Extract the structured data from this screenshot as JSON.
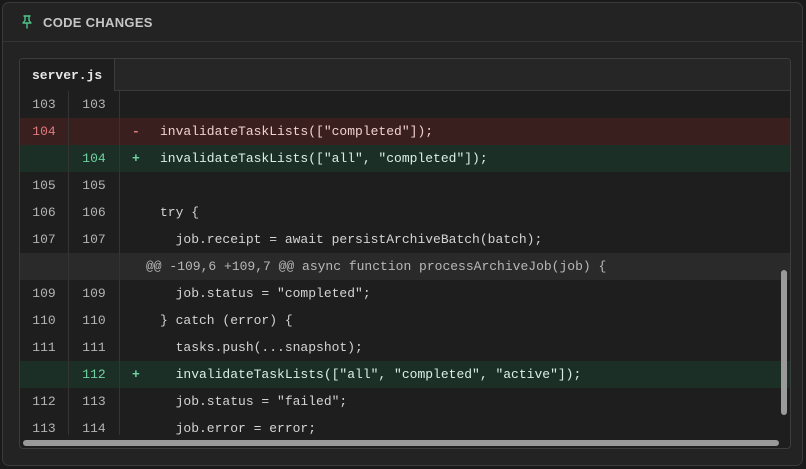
{
  "panel": {
    "title": "CODE CHANGES",
    "icon": "pin-icon",
    "accent": "#4fc38a"
  },
  "editor": {
    "tab_label": "server.js",
    "rows": [
      {
        "type": "context",
        "old": "103",
        "new": "103",
        "marker": "",
        "code": ""
      },
      {
        "type": "removed",
        "old": "104",
        "new": "",
        "marker": "-",
        "code": "invalidateTaskLists([\"completed\"]);"
      },
      {
        "type": "added",
        "old": "",
        "new": "104",
        "marker": "+",
        "code": "invalidateTaskLists([\"all\", \"completed\"]);"
      },
      {
        "type": "context",
        "old": "105",
        "new": "105",
        "marker": "",
        "code": ""
      },
      {
        "type": "context",
        "old": "106",
        "new": "106",
        "marker": "",
        "code": "try {"
      },
      {
        "type": "context",
        "old": "107",
        "new": "107",
        "marker": "",
        "code": "  job.receipt = await persistArchiveBatch(batch);"
      },
      {
        "type": "hunk",
        "old": "",
        "new": "",
        "marker": "",
        "code": "@@ -109,6 +109,7 @@ async function processArchiveJob(job) {"
      },
      {
        "type": "context",
        "old": "109",
        "new": "109",
        "marker": "",
        "code": "  job.status = \"completed\";"
      },
      {
        "type": "context",
        "old": "110",
        "new": "110",
        "marker": "",
        "code": "} catch (error) {"
      },
      {
        "type": "context",
        "old": "111",
        "new": "111",
        "marker": "",
        "code": "  tasks.push(...snapshot);"
      },
      {
        "type": "added",
        "old": "",
        "new": "112",
        "marker": "+",
        "code": "  invalidateTaskLists([\"all\", \"completed\", \"active\"]);"
      },
      {
        "type": "context",
        "old": "112",
        "new": "113",
        "marker": "",
        "code": "  job.status = \"failed\";"
      },
      {
        "type": "context",
        "old": "113",
        "new": "114",
        "marker": "",
        "code": "  job.error = error;"
      }
    ]
  },
  "colors": {
    "removed_bg": "#3a1f1f",
    "added_bg": "#1c2f26",
    "removed_fg": "#e07a7a",
    "added_fg": "#6fd2a0"
  }
}
